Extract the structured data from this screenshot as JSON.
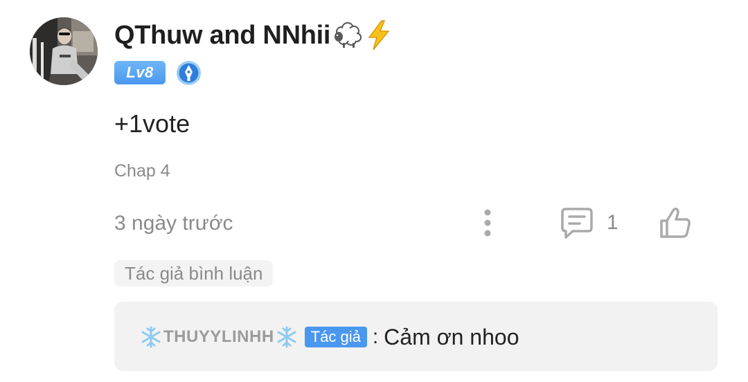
{
  "comment": {
    "username": "QThuw and NNhii",
    "name_emojis": [
      "sheep-icon",
      "lightning-icon"
    ],
    "level": "Lv8",
    "text": "+1vote",
    "chapter": "Chap 4",
    "timestamp": "3 ngày trước",
    "reply_count": "1"
  },
  "author_tag": "Tác giả bình luận",
  "reply": {
    "author": "THUYYLINHH",
    "author_decoration": "snowflake-icon",
    "badge": "Tác giả",
    "separator": ":",
    "message": "Cảm ơn nhoo"
  },
  "colors": {
    "accent_blue": "#4a97ef",
    "muted_text": "#8a8a8a",
    "reply_background": "#f2f2f2",
    "lightning": "#f6c21a"
  }
}
